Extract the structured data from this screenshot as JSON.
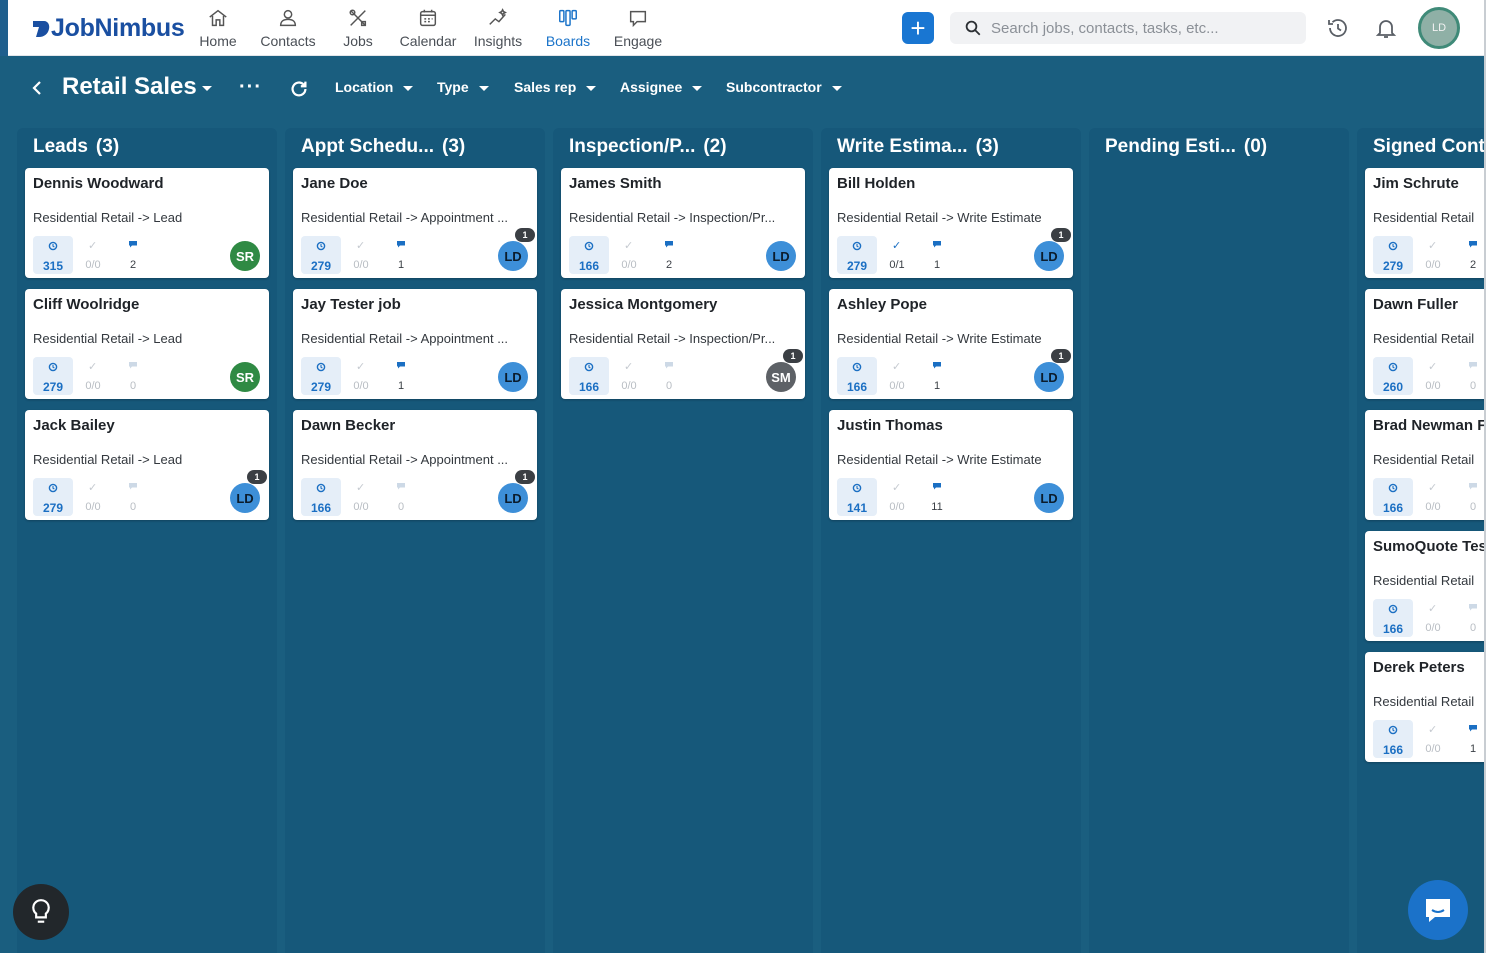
{
  "app": {
    "logo_text": "JobNimbus"
  },
  "nav": [
    {
      "id": "home",
      "label": "Home",
      "icon": "home-icon",
      "active": false
    },
    {
      "id": "contacts",
      "label": "Contacts",
      "icon": "person-icon",
      "active": false
    },
    {
      "id": "jobs",
      "label": "Jobs",
      "icon": "tools-icon",
      "active": false
    },
    {
      "id": "calendar",
      "label": "Calendar",
      "icon": "calendar-icon",
      "active": false
    },
    {
      "id": "insights",
      "label": "Insights",
      "icon": "sparkle-chart-icon",
      "active": false
    },
    {
      "id": "boards",
      "label": "Boards",
      "icon": "kanban-icon",
      "active": true
    },
    {
      "id": "engage",
      "label": "Engage",
      "icon": "chat-icon",
      "active": false
    }
  ],
  "header": {
    "search_placeholder": "Search jobs, contacts, tasks, etc...",
    "user_initials": "LD"
  },
  "board": {
    "title": "Retail Sales",
    "filters": [
      "Location",
      "Type",
      "Sales rep",
      "Assignee",
      "Subcontractor"
    ]
  },
  "colors": {
    "board_bg": "#1a5e7f",
    "column_bg": "#16587a",
    "accent": "#1976d2",
    "avatar_LD": "#3d8fd8",
    "avatar_SR": "#2f8a44",
    "avatar_SM": "#5d6166"
  },
  "columns": [
    {
      "name": "Leads",
      "count": "(3)",
      "cards": [
        {
          "name": "Dennis Woodward",
          "path": "Residential Retail -> Lead",
          "days": "315",
          "tasks": "0/0",
          "tasks_active": false,
          "notes": "2",
          "notes_active": true,
          "avatar": "SR",
          "badge": ""
        },
        {
          "name": "Cliff Woolridge",
          "path": "Residential Retail -> Lead",
          "days": "279",
          "tasks": "0/0",
          "tasks_active": false,
          "notes": "0",
          "notes_active": false,
          "avatar": "SR",
          "badge": ""
        },
        {
          "name": "Jack Bailey",
          "path": "Residential Retail -> Lead",
          "days": "279",
          "tasks": "0/0",
          "tasks_active": false,
          "notes": "0",
          "notes_active": false,
          "avatar": "LD",
          "badge": "1"
        }
      ]
    },
    {
      "name": "Appt Schedu...",
      "count": "(3)",
      "cards": [
        {
          "name": "Jane Doe",
          "path": "Residential Retail -> Appointment ...",
          "days": "279",
          "tasks": "0/0",
          "tasks_active": false,
          "notes": "1",
          "notes_active": true,
          "avatar": "LD",
          "badge": "1"
        },
        {
          "name": "Jay Tester job",
          "path": "Residential Retail -> Appointment ...",
          "days": "279",
          "tasks": "0/0",
          "tasks_active": false,
          "notes": "1",
          "notes_active": true,
          "avatar": "LD",
          "badge": ""
        },
        {
          "name": "Dawn Becker",
          "path": "Residential Retail -> Appointment ...",
          "days": "166",
          "tasks": "0/0",
          "tasks_active": false,
          "notes": "0",
          "notes_active": false,
          "avatar": "LD",
          "badge": "1"
        }
      ]
    },
    {
      "name": "Inspection/P...",
      "count": "(2)",
      "cards": [
        {
          "name": "James Smith",
          "path": "Residential Retail -> Inspection/Pr...",
          "days": "166",
          "tasks": "0/0",
          "tasks_active": false,
          "notes": "2",
          "notes_active": true,
          "avatar": "LD",
          "badge": ""
        },
        {
          "name": "Jessica Montgomery",
          "path": "Residential Retail -> Inspection/Pr...",
          "days": "166",
          "tasks": "0/0",
          "tasks_active": false,
          "notes": "0",
          "notes_active": false,
          "avatar": "SM",
          "badge": "1"
        }
      ]
    },
    {
      "name": "Write Estima...",
      "count": "(3)",
      "cards": [
        {
          "name": "Bill Holden",
          "path": "Residential Retail -> Write Estimate",
          "days": "279",
          "tasks": "0/1",
          "tasks_active": true,
          "notes": "1",
          "notes_active": true,
          "avatar": "LD",
          "badge": "1"
        },
        {
          "name": "Ashley Pope",
          "path": "Residential Retail -> Write Estimate",
          "days": "166",
          "tasks": "0/0",
          "tasks_active": false,
          "notes": "1",
          "notes_active": true,
          "avatar": "LD",
          "badge": "1"
        },
        {
          "name": "Justin Thomas",
          "path": "Residential Retail -> Write Estimate",
          "days": "141",
          "tasks": "0/0",
          "tasks_active": false,
          "notes": "11",
          "notes_active": true,
          "avatar": "LD",
          "badge": ""
        }
      ]
    },
    {
      "name": "Pending Esti...",
      "count": "(0)",
      "cards": []
    },
    {
      "name": "Signed Cont",
      "count": "",
      "cards": [
        {
          "name": "Jim Schrute",
          "path": "Residential Retail",
          "days": "279",
          "tasks": "0/0",
          "tasks_active": false,
          "notes": "2",
          "notes_active": true,
          "avatar": "",
          "badge": ""
        },
        {
          "name": "Dawn Fuller",
          "path": "Residential Retail",
          "days": "260",
          "tasks": "0/0",
          "tasks_active": false,
          "notes": "0",
          "notes_active": false,
          "avatar": "",
          "badge": ""
        },
        {
          "name": "Brad Newman F",
          "path": "Residential Retail",
          "days": "166",
          "tasks": "0/0",
          "tasks_active": false,
          "notes": "0",
          "notes_active": false,
          "avatar": "",
          "badge": ""
        },
        {
          "name": "SumoQuote Tes",
          "path": "Residential Retail",
          "days": "166",
          "tasks": "0/0",
          "tasks_active": false,
          "notes": "0",
          "notes_active": false,
          "avatar": "",
          "badge": ""
        },
        {
          "name": "Derek Peters",
          "path": "Residential Retail",
          "days": "166",
          "tasks": "0/0",
          "tasks_active": false,
          "notes": "1",
          "notes_active": true,
          "avatar": "",
          "badge": ""
        }
      ]
    }
  ]
}
